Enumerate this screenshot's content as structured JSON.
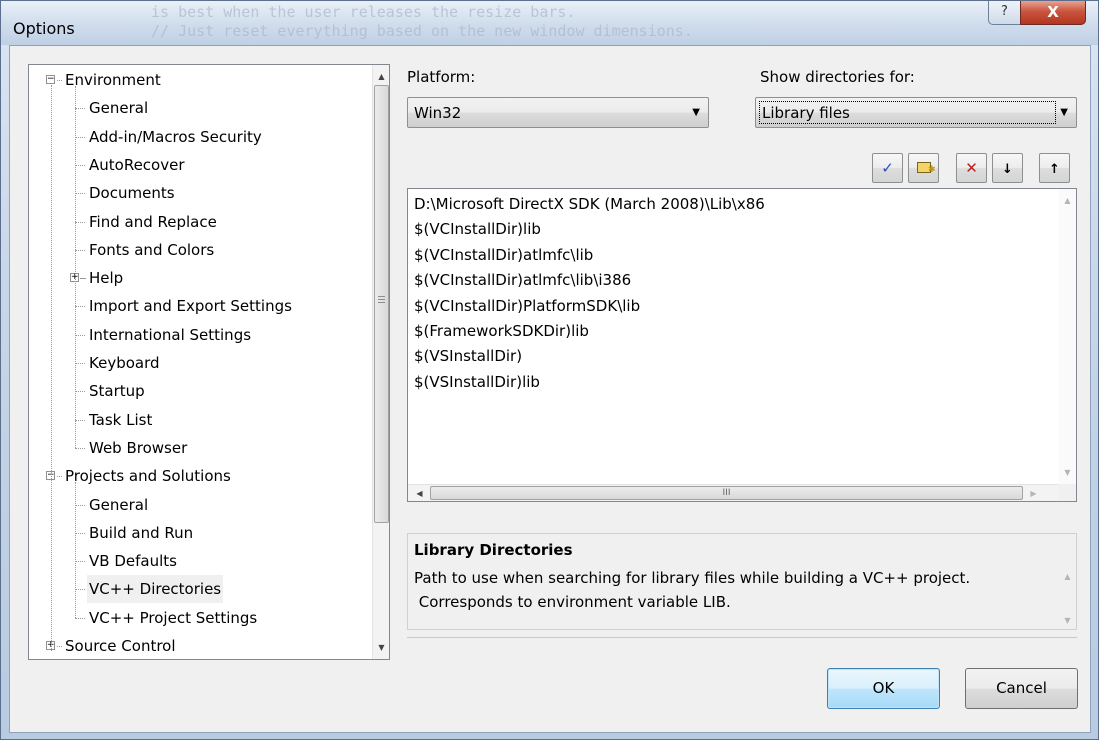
{
  "window": {
    "title": "Options",
    "ghost_text_line1": "                    is best when the user releases the resize bars.",
    "ghost_text_line2": "  // Just reset everything based on the new window dimensions.",
    "help_label": "?",
    "close_label": "X"
  },
  "tree": {
    "items": [
      {
        "label": "Environment",
        "level": 0,
        "expander": "⊟"
      },
      {
        "label": "General",
        "level": 1
      },
      {
        "label": "Add-in/Macros Security",
        "level": 1
      },
      {
        "label": "AutoRecover",
        "level": 1
      },
      {
        "label": "Documents",
        "level": 1
      },
      {
        "label": "Find and Replace",
        "level": 1
      },
      {
        "label": "Fonts and Colors",
        "level": 1
      },
      {
        "label": "Help",
        "level": 1,
        "expander": "⊞"
      },
      {
        "label": "Import and Export Settings",
        "level": 1
      },
      {
        "label": "International Settings",
        "level": 1
      },
      {
        "label": "Keyboard",
        "level": 1
      },
      {
        "label": "Startup",
        "level": 1
      },
      {
        "label": "Task List",
        "level": 1
      },
      {
        "label": "Web Browser",
        "level": 1
      },
      {
        "label": "Projects and Solutions",
        "level": 0,
        "expander": "⊟"
      },
      {
        "label": "General",
        "level": 1
      },
      {
        "label": "Build and Run",
        "level": 1
      },
      {
        "label": "VB Defaults",
        "level": 1
      },
      {
        "label": "VC++ Directories",
        "level": 1,
        "selected": true
      },
      {
        "label": "VC++ Project Settings",
        "level": 1
      },
      {
        "label": "Source Control",
        "level": 0,
        "expander": "⊞"
      }
    ]
  },
  "platform": {
    "label": "Platform:",
    "value": "Win32"
  },
  "show_dirs": {
    "label": "Show directories for:",
    "value": "Library files"
  },
  "toolbar": {
    "check": "✓",
    "new_folder": "📁",
    "delete": "✕",
    "down": "🡇",
    "up": "🡅"
  },
  "directories": [
    "D:\\Microsoft DirectX SDK (March 2008)\\Lib\\x86",
    "$(VCInstallDir)lib",
    "$(VCInstallDir)atlmfc\\lib",
    "$(VCInstallDir)atlmfc\\lib\\i386",
    "$(VCInstallDir)PlatformSDK\\lib",
    "$(FrameworkSDKDir)lib",
    "$(VSInstallDir)",
    "$(VSInstallDir)lib"
  ],
  "hscroll_grip": "III",
  "description": {
    "title": "Library Directories",
    "text_line1": "Path to use when searching for library files while building a VC++ project.",
    "text_line2": " Corresponds to environment variable LIB."
  },
  "buttons": {
    "ok": "OK",
    "cancel": "Cancel"
  }
}
